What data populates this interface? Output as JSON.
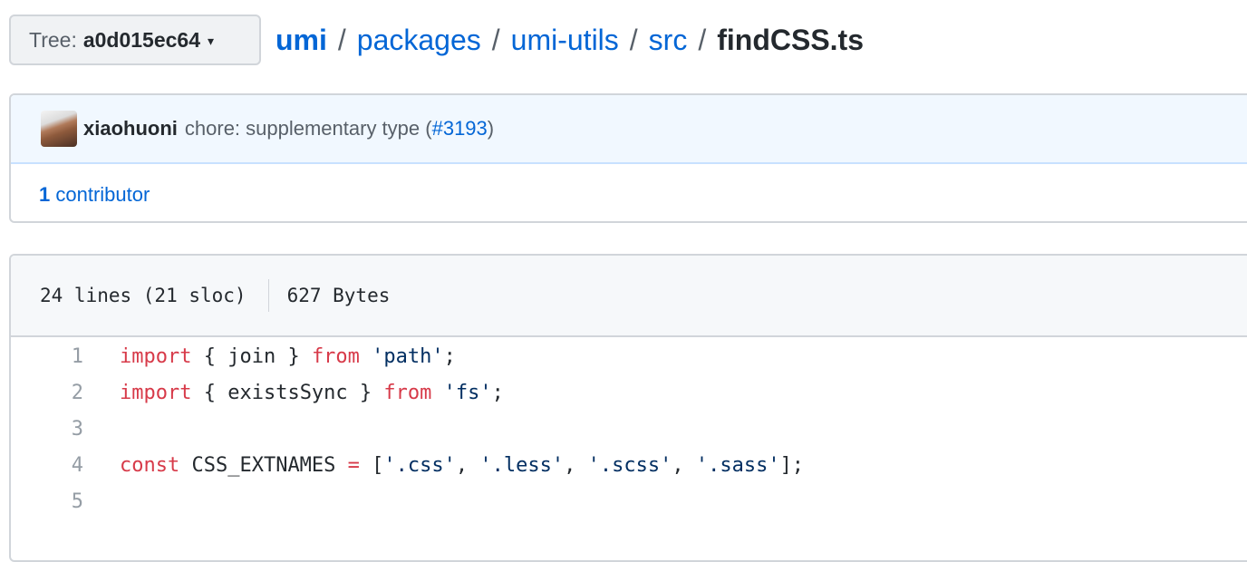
{
  "tree": {
    "label": "Tree:",
    "ref": "a0d015ec64",
    "caret": "▾"
  },
  "breadcrumb": {
    "parts": [
      "umi",
      "packages",
      "umi-utils",
      "src"
    ],
    "separator": "/",
    "file": "findCSS.ts"
  },
  "commit": {
    "author": "xiaohuoni",
    "message": "chore: supplementary type (",
    "pr": "#3193",
    "message_end": ")"
  },
  "contributors": {
    "count": "1",
    "label": "contributor"
  },
  "file_info": {
    "lines": "24 lines (21 sloc)",
    "size": "627 Bytes"
  },
  "code": [
    {
      "num": "1",
      "tokens": [
        {
          "t": "import",
          "c": "kw"
        },
        {
          "t": " { join } ",
          "c": ""
        },
        {
          "t": "from",
          "c": "kw"
        },
        {
          "t": " ",
          "c": ""
        },
        {
          "t": "'path'",
          "c": "str"
        },
        {
          "t": ";",
          "c": ""
        }
      ]
    },
    {
      "num": "2",
      "tokens": [
        {
          "t": "import",
          "c": "kw"
        },
        {
          "t": " { existsSync } ",
          "c": ""
        },
        {
          "t": "from",
          "c": "kw"
        },
        {
          "t": " ",
          "c": ""
        },
        {
          "t": "'fs'",
          "c": "str"
        },
        {
          "t": ";",
          "c": ""
        }
      ]
    },
    {
      "num": "3",
      "tokens": []
    },
    {
      "num": "4",
      "tokens": [
        {
          "t": "const",
          "c": "kw"
        },
        {
          "t": " CSS_EXTNAMES ",
          "c": ""
        },
        {
          "t": "=",
          "c": "kw"
        },
        {
          "t": " [",
          "c": ""
        },
        {
          "t": "'.css'",
          "c": "str"
        },
        {
          "t": ", ",
          "c": ""
        },
        {
          "t": "'.less'",
          "c": "str"
        },
        {
          "t": ", ",
          "c": ""
        },
        {
          "t": "'.scss'",
          "c": "str"
        },
        {
          "t": ", ",
          "c": ""
        },
        {
          "t": "'.sass'",
          "c": "str"
        },
        {
          "t": "];",
          "c": ""
        }
      ]
    },
    {
      "num": "5",
      "tokens": []
    }
  ]
}
